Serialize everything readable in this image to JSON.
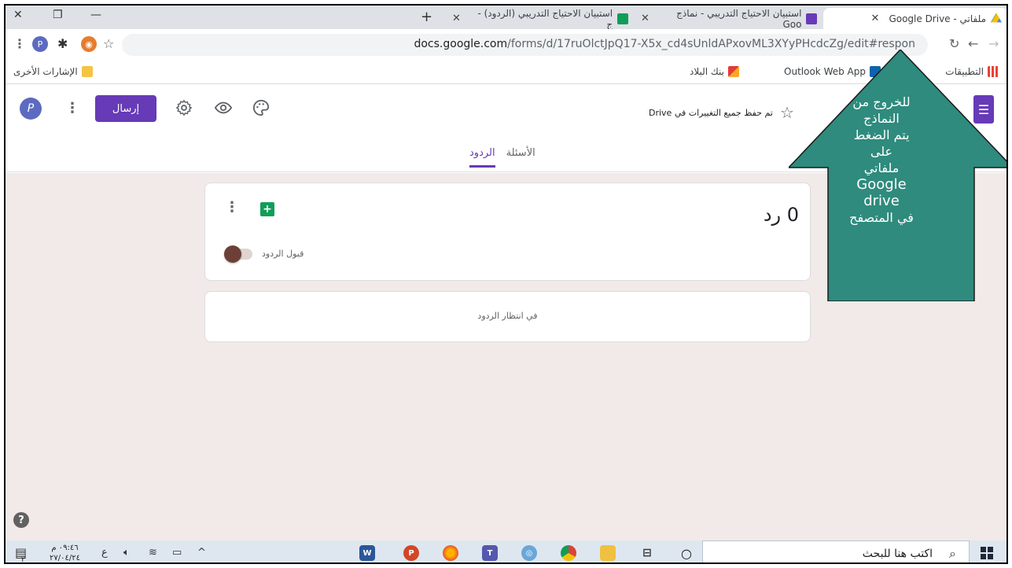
{
  "browser": {
    "tabs": [
      {
        "title": "ملفاتي - Google Drive",
        "favicon": "google-drive-icon",
        "active": true
      },
      {
        "title": "استبيان الاحتياج التدريبي - نماذج Goo",
        "favicon": "google-forms-icon",
        "active": false
      },
      {
        "title": "استبيان الاحتياج التدريبي (الردود) - ج",
        "favicon": "google-sheets-icon",
        "active": false
      }
    ],
    "new_tab": "+",
    "url_host": "docs.google.com",
    "url_path": "/forms/d/17ruOlctJpQ17-X5x_cd4sUnldAPxovML3XYyPHcdcZg/edit#respon",
    "bookmarks": [
      {
        "label": "التطبيقات",
        "icon": "apps-grid-icon"
      },
      {
        "label": "Outlook Web App",
        "icon": "outlook-icon"
      },
      {
        "label": "بنك البلاد",
        "icon": "bank-albilad-icon"
      }
    ],
    "other_bookmarks": "الإشارات الأخرى",
    "extensions": {
      "profile_letter": "P"
    }
  },
  "forms": {
    "saved_status": "تم حفظ جميع التغييرات في Drive",
    "send_label": "إرسال",
    "avatar_letter": "P",
    "tabs": [
      {
        "label": "الأسئلة",
        "selected": false
      },
      {
        "label": "الردود",
        "selected": true
      }
    ],
    "responses_count": "0 رد",
    "accepting_label": "قبول الردود",
    "accepting_responses": false,
    "waiting_label": "في انتظار الردود"
  },
  "callout": {
    "lines": [
      "للخروج من",
      "النماذج",
      "يتم الضغط",
      "على",
      "ملفاتي",
      "Google",
      "drive",
      "في المتصفح"
    ],
    "fill_color": "#2e8b7d"
  },
  "taskbar": {
    "search_placeholder": "اكتب هنا للبحث",
    "time": "٠٩:٤٦ م",
    "date": "٢٧/٠٤/٢٤",
    "lang": "ع",
    "notification_count": "٢"
  },
  "colors": {
    "forms_purple": "#673ab7",
    "content_bg": "#f2eae8",
    "toggle_knob": "#6d4037"
  }
}
